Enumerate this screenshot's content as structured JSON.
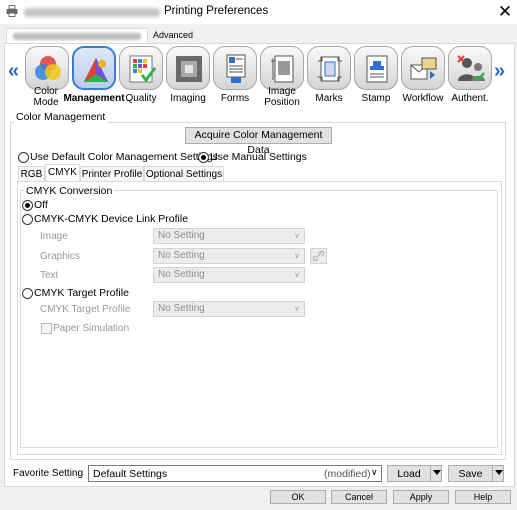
{
  "window": {
    "title": "Printing Preferences",
    "close_glyph": "✕"
  },
  "top_tabs": [
    {
      "label": ""
    },
    {
      "label": "Advanced"
    }
  ],
  "toolbar": {
    "left_arrow": "«",
    "right_arrow": "»",
    "items": [
      {
        "label": "Color Mode",
        "icon": "color-mode-icon"
      },
      {
        "label": "Management",
        "icon": "color-management-icon",
        "selected": true
      },
      {
        "label": "Quality",
        "icon": "quality-icon"
      },
      {
        "label": "Imaging",
        "icon": "imaging-icon"
      },
      {
        "label": "Forms",
        "icon": "forms-icon"
      },
      {
        "label": "Image Position",
        "icon": "image-position-icon"
      },
      {
        "label": "Marks",
        "icon": "marks-icon"
      },
      {
        "label": "Stamp",
        "icon": "stamp-icon"
      },
      {
        "label": "Workflow",
        "icon": "workflow-icon"
      },
      {
        "label": "Authent.",
        "icon": "authentication-icon"
      }
    ]
  },
  "color_management": {
    "title": "Color Management",
    "acquire_button": "Acquire Color Management Data",
    "use_default": "Use Default Color Management Settings",
    "use_manual": "Use Manual Settings",
    "selected": "manual",
    "tabs": [
      "RGB",
      "CMYK",
      "Printer Profile",
      "Optional Settings"
    ],
    "active_tab": "CMYK",
    "cmyk_conversion": {
      "title": "CMYK Conversion",
      "off": "Off",
      "device_link": "CMYK-CMYK Device Link Profile",
      "image_label": "Image",
      "image_value": "No Setting",
      "graphics_label": "Graphics",
      "graphics_value": "No Setting",
      "text_label": "Text",
      "text_value": "No Setting",
      "target_profile": "CMYK Target Profile",
      "target_profile_label": "CMYK Target Profile",
      "target_profile_value": "No Setting",
      "paper_simulation": "Paper Simulation",
      "selected": "off"
    }
  },
  "favorite": {
    "label": "Favorite Setting",
    "value": "Default Settings",
    "modified": "(modified)",
    "load": "Load",
    "save": "Save"
  },
  "dialog_buttons": {
    "ok": "OK",
    "cancel": "Cancel",
    "apply": "Apply",
    "help": "Help"
  }
}
